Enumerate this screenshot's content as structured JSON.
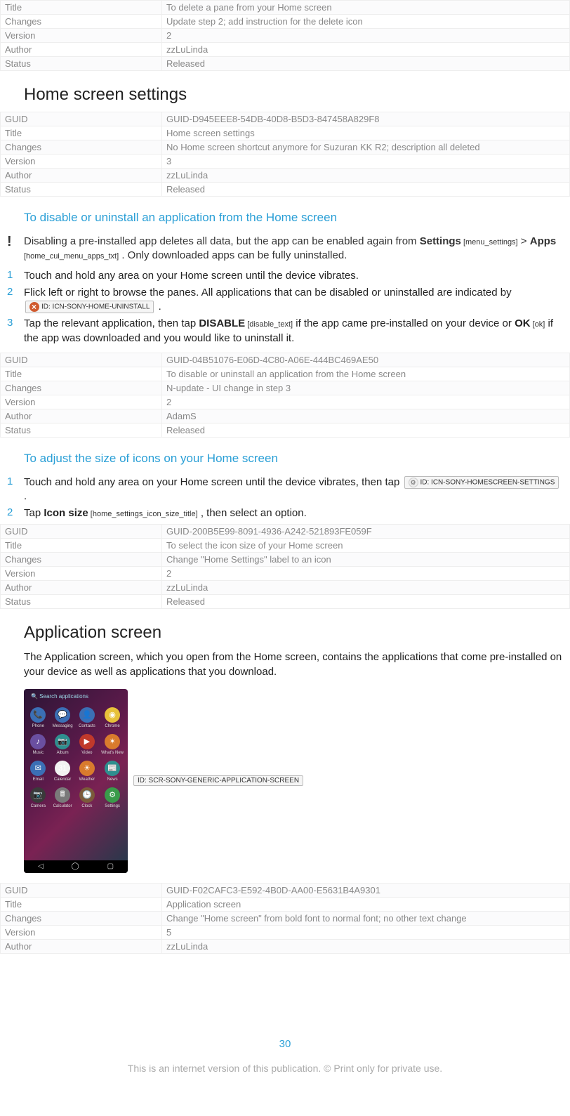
{
  "meta_tables": {
    "t1": {
      "rows": [
        {
          "k": "Title",
          "v": "To delete a pane from your Home screen"
        },
        {
          "k": "Changes",
          "v": "Update step 2; add instruction for the delete icon"
        },
        {
          "k": "Version",
          "v": "2"
        },
        {
          "k": "Author",
          "v": "zzLuLinda"
        },
        {
          "k": "Status",
          "v": "Released"
        }
      ]
    },
    "t2": {
      "rows": [
        {
          "k": "GUID",
          "v": "GUID-D945EEE8-54DB-40D8-B5D3-847458A829F8"
        },
        {
          "k": "Title",
          "v": "Home screen settings"
        },
        {
          "k": "Changes",
          "v": "No Home screen shortcut anymore for Suzuran KK R2; description all deleted"
        },
        {
          "k": "Version",
          "v": "3"
        },
        {
          "k": "Author",
          "v": "zzLuLinda"
        },
        {
          "k": "Status",
          "v": "Released"
        }
      ]
    },
    "t3": {
      "rows": [
        {
          "k": "GUID",
          "v": "GUID-04B51076-E06D-4C80-A06E-444BC469AE50"
        },
        {
          "k": "Title",
          "v": "To disable or uninstall an application from the Home screen"
        },
        {
          "k": "Changes",
          "v": "N-update - UI change in step 3"
        },
        {
          "k": "Version",
          "v": "2"
        },
        {
          "k": "Author",
          "v": "AdamS"
        },
        {
          "k": "Status",
          "v": "Released"
        }
      ]
    },
    "t4": {
      "rows": [
        {
          "k": "GUID",
          "v": "GUID-200B5E99-8091-4936-A242-521893FE059F"
        },
        {
          "k": "Title",
          "v": "To select the icon size of your Home screen"
        },
        {
          "k": "Changes",
          "v": "Change \"Home Settings\" label to an icon"
        },
        {
          "k": "Version",
          "v": "2"
        },
        {
          "k": "Author",
          "v": "zzLuLinda"
        },
        {
          "k": "Status",
          "v": "Released"
        }
      ]
    },
    "t5": {
      "rows": [
        {
          "k": "GUID",
          "v": "GUID-F02CAFC3-E592-4B0D-AA00-E5631B4A9301"
        },
        {
          "k": "Title",
          "v": "Application screen"
        },
        {
          "k": "Changes",
          "v": "Change \"Home screen\" from bold font to normal font; no other text change"
        },
        {
          "k": "Version",
          "v": "5"
        },
        {
          "k": "Author",
          "v": "zzLuLinda"
        }
      ]
    }
  },
  "headings": {
    "home_screen_settings": "Home screen settings",
    "disable_uninstall": "To disable or uninstall an application from the Home screen",
    "adjust_icon_size": "To adjust the size of icons on your Home screen",
    "application_screen": "Application screen"
  },
  "note1": {
    "marker": "!",
    "pre": "Disabling a pre-installed app deletes all data, but the app can be enabled again from ",
    "settings_bold": "Settings",
    "settings_key": " [menu_settings]",
    "gt": " > ",
    "apps_bold": "Apps",
    "apps_key": " [home_cui_menu_apps_txt]",
    "tail": " . Only downloaded apps can be fully uninstalled."
  },
  "disable_steps": {
    "s1": {
      "num": "1",
      "text": "Touch and hold any area on your Home screen until the device vibrates."
    },
    "s2": {
      "num": "2",
      "pre": "Flick left or right to browse the panes. All applications that can be disabled or uninstalled are indicated by ",
      "id_box": "ID: ICN-SONY-HOME-UNINSTALL",
      "tail": " ."
    },
    "s3": {
      "num": "3",
      "pre": "Tap the relevant application, then tap ",
      "disable_bold": "DISABLE",
      "disable_key": " [disable_text]",
      "mid": " if the app came pre-installed on your device or ",
      "ok_bold": "OK",
      "ok_key": " [ok]",
      "tail": " if the app was downloaded and you would like to uninstall it."
    }
  },
  "adjust_steps": {
    "s1": {
      "num": "1",
      "pre": "Touch and hold any area on your Home screen until the device vibrates, then tap ",
      "id_box": "ID: ICN-SONY-HOMESCREEN-SETTINGS",
      "tail": " ."
    },
    "s2": {
      "num": "2",
      "pre": "Tap ",
      "iconsize_bold": "Icon size",
      "iconsize_key": " [home_settings_icon_size_title]",
      "tail": " , then select an option."
    }
  },
  "application_body": "The Application screen, which you open from the Home screen, contains the applications that come pre-installed on your device as well as applications that you download.",
  "screenshot_id": "ID: SCR-SONY-GENERIC-APPLICATION-SCREEN",
  "phone": {
    "search": "🔍 Search applications",
    "apps": [
      {
        "glyph": "📞",
        "label": "Phone",
        "color": "bg-blue"
      },
      {
        "glyph": "💬",
        "label": "Messaging",
        "color": "bg-blue"
      },
      {
        "glyph": "👤",
        "label": "Contacts",
        "color": "bg-blue"
      },
      {
        "glyph": "◉",
        "label": "Chrome",
        "color": "bg-yellow"
      },
      {
        "glyph": "♪",
        "label": "Music",
        "color": "bg-purple2"
      },
      {
        "glyph": "📷",
        "label": "Album",
        "color": "bg-teal"
      },
      {
        "glyph": "▶",
        "label": "Video",
        "color": "bg-red"
      },
      {
        "glyph": "✶",
        "label": "What's New",
        "color": "bg-orange"
      },
      {
        "glyph": "✉",
        "label": "Email",
        "color": "bg-blue"
      },
      {
        "glyph": "31",
        "label": "Calendar",
        "color": "bg-white"
      },
      {
        "glyph": "☀",
        "label": "Weather",
        "color": "bg-orange"
      },
      {
        "glyph": "📰",
        "label": "News",
        "color": "bg-teal"
      },
      {
        "glyph": "📷",
        "label": "Camera",
        "color": "bg-dark"
      },
      {
        "glyph": "🖩",
        "label": "Calculator",
        "color": "bg-gray"
      },
      {
        "glyph": "🕒",
        "label": "Clock",
        "color": "bg-brown"
      },
      {
        "glyph": "⚙",
        "label": "Settings",
        "color": "bg-green"
      }
    ],
    "nav": {
      "back": "◁",
      "home": "◯",
      "recent": "▢"
    }
  },
  "page_number": "30",
  "footer": "This is an internet version of this publication. © Print only for private use."
}
